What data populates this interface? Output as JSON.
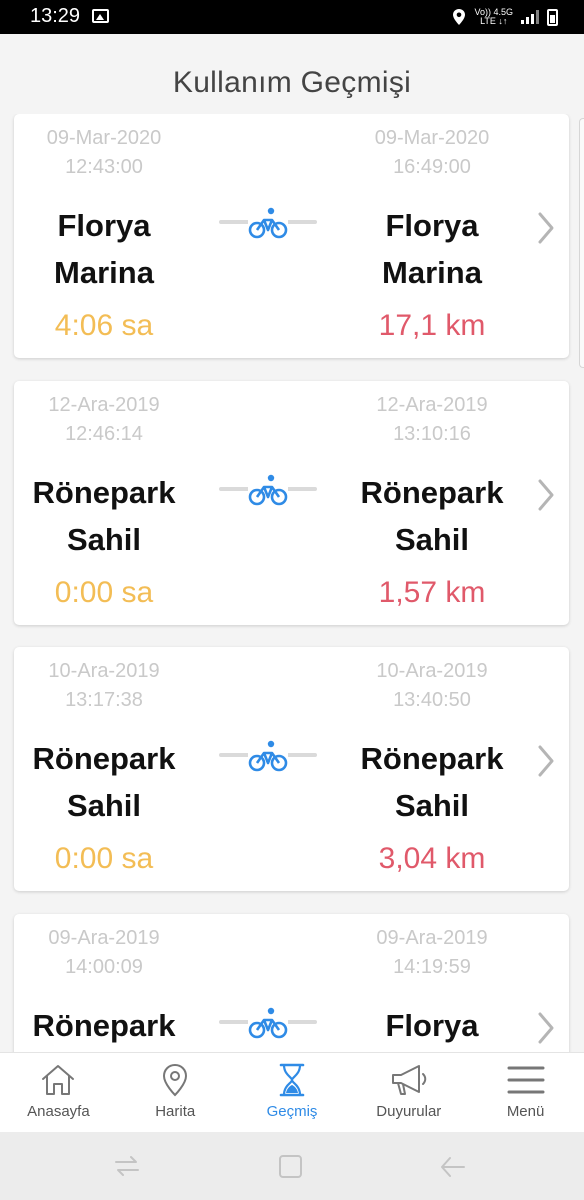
{
  "status_bar": {
    "time": "13:29",
    "network_top": "Vo)) 4.5G",
    "network_bottom": "LTE ↓↑"
  },
  "page": {
    "title": "Kullanım Geçmişi"
  },
  "trips": [
    {
      "start_date": "09-Mar-2020",
      "start_time": "12:43:00",
      "end_date": "09-Mar-2020",
      "end_time": "16:49:00",
      "start_station_line1": "Florya",
      "start_station_line2": "Marina",
      "end_station_line1": "Florya",
      "end_station_line2": "Marina",
      "duration": "4:06 sa",
      "distance": "17,1 km"
    },
    {
      "start_date": "12-Ara-2019",
      "start_time": "12:46:14",
      "end_date": "12-Ara-2019",
      "end_time": "13:10:16",
      "start_station_line1": "Rönepark",
      "start_station_line2": "Sahil",
      "end_station_line1": "Rönepark",
      "end_station_line2": "Sahil",
      "duration": "0:00 sa",
      "distance": "1,57 km"
    },
    {
      "start_date": "10-Ara-2019",
      "start_time": "13:17:38",
      "end_date": "10-Ara-2019",
      "end_time": "13:40:50",
      "start_station_line1": "Rönepark",
      "start_station_line2": "Sahil",
      "end_station_line1": "Rönepark",
      "end_station_line2": "Sahil",
      "duration": "0:00 sa",
      "distance": "3,04 km"
    },
    {
      "start_date": "09-Ara-2019",
      "start_time": "14:00:09",
      "end_date": "09-Ara-2019",
      "end_time": "14:19:59",
      "start_station_line1": "Rönepark",
      "start_station_line2": "",
      "end_station_line1": "Florya",
      "end_station_line2": "",
      "duration": "",
      "distance": ""
    }
  ],
  "bottom_nav": {
    "items": [
      {
        "label": "Anasayfa",
        "icon": "home-icon"
      },
      {
        "label": "Harita",
        "icon": "map-pin-icon"
      },
      {
        "label": "Geçmiş",
        "icon": "hourglass-icon",
        "active": true
      },
      {
        "label": "Duyurular",
        "icon": "megaphone-icon"
      },
      {
        "label": "Menü",
        "icon": "hamburger-menu-icon"
      }
    ]
  },
  "colors": {
    "duration": "#f3bd55",
    "distance": "#e0596a",
    "accent": "#2f8be6",
    "timestamp": "#c9c9c9"
  }
}
